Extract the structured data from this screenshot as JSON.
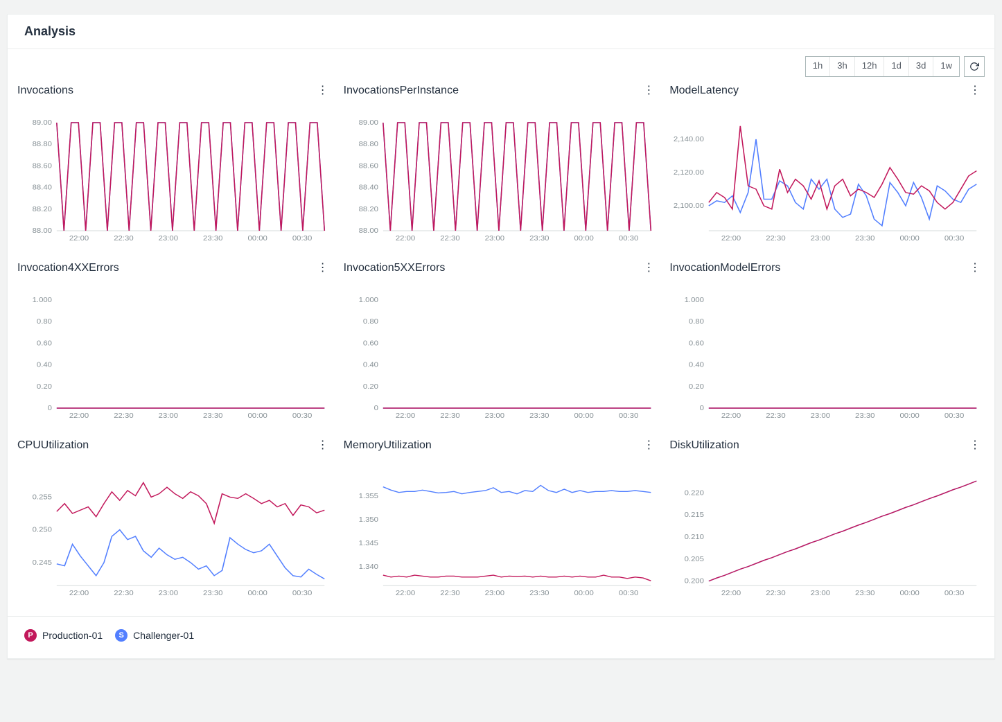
{
  "header": {
    "title": "Analysis"
  },
  "toolbar": {
    "ranges": [
      "1h",
      "3h",
      "12h",
      "1d",
      "3d",
      "1w"
    ]
  },
  "legend": [
    {
      "badge": "P",
      "label": "Production-01",
      "color": "#c2185b"
    },
    {
      "badge": "S",
      "label": "Challenger-01",
      "color": "#527fff"
    }
  ],
  "x_ticks": [
    "22:00",
    "22:30",
    "23:00",
    "23:30",
    "00:00",
    "00:30"
  ],
  "colors": {
    "production": "#c2185b",
    "challenger": "#527fff"
  },
  "chart_data": [
    {
      "name": "Invocations",
      "type": "line",
      "xlabel": "",
      "ylabel": "",
      "x_ticks": [
        "22:00",
        "22:30",
        "23:00",
        "23:30",
        "00:00",
        "00:30"
      ],
      "y_ticks": [
        88.0,
        88.2,
        88.4,
        88.6,
        88.8,
        89.0
      ],
      "ylim": [
        88.0,
        89.0
      ],
      "series": [
        {
          "name": "Challenger-01",
          "color": "#527fff",
          "values": [
            89,
            88,
            89,
            89,
            88,
            89,
            89,
            88,
            89,
            89,
            88,
            89,
            89,
            88,
            89,
            89,
            88,
            89,
            89,
            88,
            89,
            89,
            88,
            89,
            89,
            88,
            89,
            89,
            88,
            89,
            89,
            88,
            89,
            89,
            88,
            89,
            89,
            88
          ]
        },
        {
          "name": "Production-01",
          "color": "#c2185b",
          "values": [
            89,
            88,
            89,
            89,
            88,
            89,
            89,
            88,
            89,
            89,
            88,
            89,
            89,
            88,
            89,
            89,
            88,
            89,
            89,
            88,
            89,
            89,
            88,
            89,
            89,
            88,
            89,
            89,
            88,
            89,
            89,
            88,
            89,
            89,
            88,
            89,
            89,
            88
          ]
        }
      ]
    },
    {
      "name": "InvocationsPerInstance",
      "type": "line",
      "x_ticks": [
        "22:00",
        "22:30",
        "23:00",
        "23:30",
        "00:00",
        "00:30"
      ],
      "y_ticks": [
        88.0,
        88.2,
        88.4,
        88.6,
        88.8,
        89.0
      ],
      "ylim": [
        88.0,
        89.0
      ],
      "series": [
        {
          "name": "Challenger-01",
          "color": "#527fff",
          "values": [
            89,
            88,
            89,
            89,
            88,
            89,
            89,
            88,
            89,
            89,
            88,
            89,
            89,
            88,
            89,
            89,
            88,
            89,
            89,
            88,
            89,
            89,
            88,
            89,
            89,
            88,
            89,
            89,
            88,
            89,
            89,
            88,
            89,
            89,
            88,
            89,
            89,
            88
          ]
        },
        {
          "name": "Production-01",
          "color": "#c2185b",
          "values": [
            89,
            88,
            89,
            89,
            88,
            89,
            89,
            88,
            89,
            89,
            88,
            89,
            89,
            88,
            89,
            89,
            88,
            89,
            89,
            88,
            89,
            89,
            88,
            89,
            89,
            88,
            89,
            89,
            88,
            89,
            89,
            88,
            89,
            89,
            88,
            89,
            89,
            88
          ]
        }
      ]
    },
    {
      "name": "ModelLatency",
      "type": "line",
      "x_ticks": [
        "22:00",
        "22:30",
        "23:00",
        "23:30",
        "00:00",
        "00:30"
      ],
      "y_ticks": [
        2100.0,
        2120.0,
        2140.0
      ],
      "ylim": [
        2085,
        2150
      ],
      "series": [
        {
          "name": "Challenger-01",
          "color": "#527fff",
          "values": [
            2100,
            2103,
            2102,
            2106,
            2096,
            2108,
            2140,
            2104,
            2104,
            2115,
            2112,
            2102,
            2098,
            2116,
            2110,
            2116,
            2098,
            2093,
            2095,
            2113,
            2106,
            2092,
            2088,
            2114,
            2108,
            2100,
            2114,
            2105,
            2092,
            2112,
            2109,
            2104,
            2102,
            2110,
            2113
          ]
        },
        {
          "name": "Production-01",
          "color": "#c2185b",
          "values": [
            2102,
            2108,
            2105,
            2098,
            2148,
            2112,
            2110,
            2100,
            2098,
            2122,
            2108,
            2116,
            2112,
            2104,
            2115,
            2098,
            2112,
            2116,
            2106,
            2110,
            2108,
            2105,
            2113,
            2123,
            2116,
            2108,
            2107,
            2112,
            2109,
            2102,
            2098,
            2102,
            2110,
            2118,
            2121
          ]
        }
      ]
    },
    {
      "name": "Invocation4XXErrors",
      "type": "line",
      "x_ticks": [
        "22:00",
        "22:30",
        "23:00",
        "23:30",
        "00:00",
        "00:30"
      ],
      "y_ticks": [
        0,
        0.2,
        0.4,
        0.6,
        0.8,
        1.0
      ],
      "ylim": [
        0,
        1.0
      ],
      "series": [
        {
          "name": "Challenger-01",
          "color": "#527fff",
          "values": [
            0,
            0,
            0,
            0,
            0,
            0,
            0,
            0,
            0,
            0,
            0,
            0,
            0,
            0,
            0,
            0,
            0,
            0,
            0,
            0,
            0,
            0,
            0,
            0,
            0,
            0,
            0,
            0,
            0,
            0,
            0,
            0,
            0,
            0,
            0
          ]
        },
        {
          "name": "Production-01",
          "color": "#c2185b",
          "values": [
            0,
            0,
            0,
            0,
            0,
            0,
            0,
            0,
            0,
            0,
            0,
            0,
            0,
            0,
            0,
            0,
            0,
            0,
            0,
            0,
            0,
            0,
            0,
            0,
            0,
            0,
            0,
            0,
            0,
            0,
            0,
            0,
            0,
            0,
            0
          ]
        }
      ]
    },
    {
      "name": "Invocation5XXErrors",
      "type": "line",
      "x_ticks": [
        "22:00",
        "22:30",
        "23:00",
        "23:30",
        "00:00",
        "00:30"
      ],
      "y_ticks": [
        0,
        0.2,
        0.4,
        0.6,
        0.8,
        1.0
      ],
      "ylim": [
        0,
        1.0
      ],
      "series": [
        {
          "name": "Challenger-01",
          "color": "#527fff",
          "values": [
            0,
            0,
            0,
            0,
            0,
            0,
            0,
            0,
            0,
            0,
            0,
            0,
            0,
            0,
            0,
            0,
            0,
            0,
            0,
            0,
            0,
            0,
            0,
            0,
            0,
            0,
            0,
            0,
            0,
            0,
            0,
            0,
            0,
            0,
            0
          ]
        },
        {
          "name": "Production-01",
          "color": "#c2185b",
          "values": [
            0,
            0,
            0,
            0,
            0,
            0,
            0,
            0,
            0,
            0,
            0,
            0,
            0,
            0,
            0,
            0,
            0,
            0,
            0,
            0,
            0,
            0,
            0,
            0,
            0,
            0,
            0,
            0,
            0,
            0,
            0,
            0,
            0,
            0,
            0
          ]
        }
      ]
    },
    {
      "name": "InvocationModelErrors",
      "type": "line",
      "x_ticks": [
        "22:00",
        "22:30",
        "23:00",
        "23:30",
        "00:00",
        "00:30"
      ],
      "y_ticks": [
        0,
        0.2,
        0.4,
        0.6,
        0.8,
        1.0
      ],
      "ylim": [
        0,
        1.0
      ],
      "series": [
        {
          "name": "Challenger-01",
          "color": "#527fff",
          "values": [
            0,
            0,
            0,
            0,
            0,
            0,
            0,
            0,
            0,
            0,
            0,
            0,
            0,
            0,
            0,
            0,
            0,
            0,
            0,
            0,
            0,
            0,
            0,
            0,
            0,
            0,
            0,
            0,
            0,
            0,
            0,
            0,
            0,
            0,
            0
          ]
        },
        {
          "name": "Production-01",
          "color": "#c2185b",
          "values": [
            0,
            0,
            0,
            0,
            0,
            0,
            0,
            0,
            0,
            0,
            0,
            0,
            0,
            0,
            0,
            0,
            0,
            0,
            0,
            0,
            0,
            0,
            0,
            0,
            0,
            0,
            0,
            0,
            0,
            0,
            0,
            0,
            0,
            0,
            0
          ]
        }
      ]
    },
    {
      "name": "CPUUtilization",
      "type": "line",
      "x_ticks": [
        "22:00",
        "22:30",
        "23:00",
        "23:30",
        "00:00",
        "00:30"
      ],
      "y_ticks": [
        0.245,
        0.25,
        0.255
      ],
      "ylim": [
        0.2415,
        0.258
      ],
      "series": [
        {
          "name": "Challenger-01",
          "color": "#527fff",
          "values": [
            0.2448,
            0.2445,
            0.2478,
            0.246,
            0.2445,
            0.243,
            0.245,
            0.249,
            0.25,
            0.2485,
            0.249,
            0.2468,
            0.2458,
            0.2472,
            0.2462,
            0.2455,
            0.2458,
            0.245,
            0.244,
            0.2445,
            0.243,
            0.2438,
            0.2488,
            0.2478,
            0.247,
            0.2465,
            0.2468,
            0.2478,
            0.246,
            0.2442,
            0.243,
            0.2428,
            0.244,
            0.2432,
            0.2425
          ]
        },
        {
          "name": "Production-01",
          "color": "#c2185b",
          "values": [
            0.2528,
            0.254,
            0.2525,
            0.253,
            0.2535,
            0.252,
            0.254,
            0.2558,
            0.2545,
            0.256,
            0.2552,
            0.2572,
            0.255,
            0.2555,
            0.2565,
            0.2555,
            0.2548,
            0.2558,
            0.2552,
            0.254,
            0.251,
            0.2555,
            0.255,
            0.2548,
            0.2555,
            0.2548,
            0.254,
            0.2545,
            0.2535,
            0.254,
            0.2522,
            0.2538,
            0.2535,
            0.2526,
            0.253
          ]
        }
      ]
    },
    {
      "name": "MemoryUtilization",
      "type": "line",
      "x_ticks": [
        "22:00",
        "22:30",
        "23:00",
        "23:30",
        "00:00",
        "00:30"
      ],
      "y_ticks": [
        1.34,
        1.345,
        1.35,
        1.355
      ],
      "ylim": [
        1.336,
        1.359
      ],
      "series": [
        {
          "name": "Challenger-01",
          "color": "#527fff",
          "values": [
            1.357,
            1.3563,
            1.3558,
            1.356,
            1.356,
            1.3563,
            1.356,
            1.3557,
            1.3558,
            1.356,
            1.3555,
            1.3558,
            1.356,
            1.3562,
            1.3568,
            1.3558,
            1.356,
            1.3555,
            1.3562,
            1.356,
            1.3573,
            1.3562,
            1.3558,
            1.3565,
            1.3558,
            1.3562,
            1.3558,
            1.356,
            1.356,
            1.3562,
            1.356,
            1.356,
            1.3562,
            1.356,
            1.3558
          ]
        },
        {
          "name": "Production-01",
          "color": "#c2185b",
          "values": [
            1.3382,
            1.3378,
            1.338,
            1.3378,
            1.3382,
            1.338,
            1.3378,
            1.3378,
            1.338,
            1.338,
            1.3378,
            1.3378,
            1.3378,
            1.338,
            1.3382,
            1.3378,
            1.338,
            1.3379,
            1.338,
            1.3378,
            1.338,
            1.3378,
            1.3378,
            1.338,
            1.3378,
            1.338,
            1.3378,
            1.3378,
            1.3382,
            1.3378,
            1.3378,
            1.3375,
            1.3378,
            1.3376,
            1.337
          ]
        }
      ]
    },
    {
      "name": "DiskUtilization",
      "type": "line",
      "x_ticks": [
        "22:00",
        "22:30",
        "23:00",
        "23:30",
        "00:00",
        "00:30"
      ],
      "y_ticks": [
        0.2,
        0.205,
        0.21,
        0.215,
        0.22
      ],
      "ylim": [
        0.199,
        0.2235
      ],
      "series": [
        {
          "name": "Challenger-01",
          "color": "#527fff",
          "values": [
            0.2,
            0.2007,
            0.2013,
            0.202,
            0.2027,
            0.2033,
            0.204,
            0.2047,
            0.2053,
            0.206,
            0.2067,
            0.2073,
            0.208,
            0.2087,
            0.2093,
            0.21,
            0.2107,
            0.2113,
            0.212,
            0.2127,
            0.2133,
            0.214,
            0.2147,
            0.2153,
            0.216,
            0.2167,
            0.2173,
            0.218,
            0.2187,
            0.2193,
            0.22,
            0.2207,
            0.2213,
            0.222,
            0.2227
          ]
        },
        {
          "name": "Production-01",
          "color": "#c2185b",
          "values": [
            0.2,
            0.2007,
            0.2013,
            0.202,
            0.2027,
            0.2033,
            0.204,
            0.2047,
            0.2053,
            0.206,
            0.2067,
            0.2073,
            0.208,
            0.2087,
            0.2093,
            0.21,
            0.2107,
            0.2113,
            0.212,
            0.2127,
            0.2133,
            0.214,
            0.2147,
            0.2153,
            0.216,
            0.2167,
            0.2173,
            0.218,
            0.2187,
            0.2193,
            0.22,
            0.2207,
            0.2213,
            0.222,
            0.2227
          ]
        }
      ]
    }
  ]
}
